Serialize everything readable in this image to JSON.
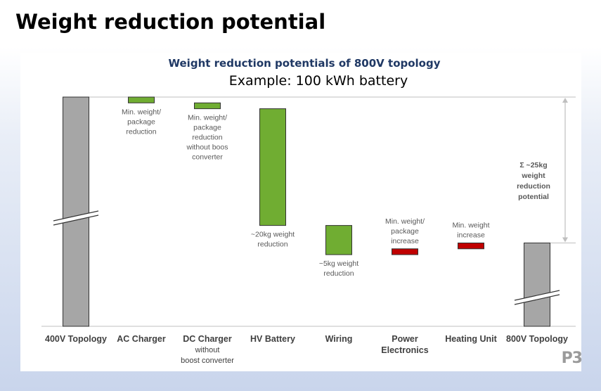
{
  "slide": {
    "title": "Weight reduction potential",
    "logo_text": "P3"
  },
  "chart_data": {
    "type": "bar",
    "subtype": "waterfall",
    "title": "Weight reduction potentials of 800V topology",
    "subtitle": "Example: 100 kWh battery",
    "categories": [
      [
        "400V Topology"
      ],
      [
        "AC Charger"
      ],
      [
        "DC Charger",
        "without",
        "boost converter"
      ],
      [
        "HV Battery"
      ],
      [
        "Wiring"
      ],
      [
        "Power",
        "Electronics"
      ],
      [
        "Heating Unit"
      ],
      [
        "800V Topology"
      ]
    ],
    "values_kg": [
      null,
      -1,
      -1,
      -20,
      -5,
      1,
      1,
      null
    ],
    "value_labels": [
      [],
      [
        "Min. weight/",
        "package",
        "reduction"
      ],
      [
        "Min. weight/",
        "package",
        "reduction",
        "without boos",
        "converter"
      ],
      [
        "~20kg weight",
        "reduction"
      ],
      [
        "~5kg weight",
        "reduction"
      ],
      [
        "Min. weight/",
        "package",
        "increase"
      ],
      [
        "Min. weight",
        "increase"
      ],
      []
    ],
    "bar_kinds": [
      "total",
      "decrease",
      "decrease",
      "decrease",
      "decrease",
      "increase",
      "increase",
      "total"
    ],
    "axis_break_on_totals": true,
    "total_change_annotation": [
      "Σ ~25kg",
      "weight",
      "reduction",
      "potential"
    ],
    "colors": {
      "total": "#a6a6a6",
      "decrease": "#70ad32",
      "increase": "#c00000",
      "title": "#1f3864",
      "label": "#595959",
      "category": "#404040",
      "gridline": "#bfbfbf"
    },
    "grid": false,
    "legend": "none"
  }
}
